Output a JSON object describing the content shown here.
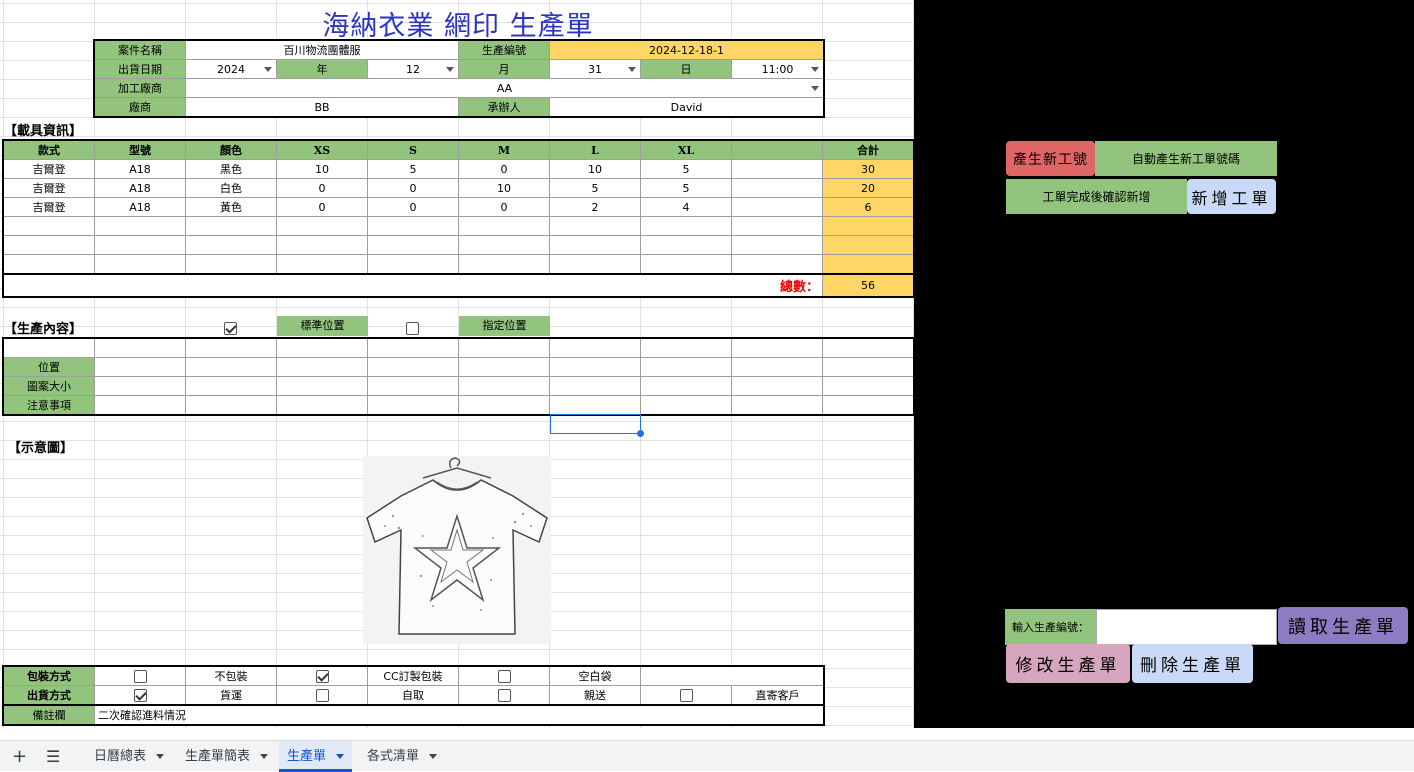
{
  "title": "海納衣業 網印 生產單",
  "info": {
    "case_label": "案件名稱",
    "case_value": "百川物流團體服",
    "prod_no_label": "生產編號",
    "prod_no_value": "2024-12-18-1",
    "ship_label": "出貨日期",
    "year_val": "2024",
    "year_lbl": "年",
    "month_val": "12",
    "month_lbl": "月",
    "day_val": "31",
    "day_lbl": "日",
    "time_val": "11:00",
    "processor_label": "加工廠商",
    "processor_value": "AA",
    "vendor_label": "廠商",
    "vendor_value": "BB",
    "handler_label": "承辦人",
    "handler_value": "David"
  },
  "carrier": {
    "section": "【載具資訊】",
    "headers": [
      "款式",
      "型號",
      "顏色",
      "XS",
      "S",
      "M",
      "L",
      "XL",
      "",
      "合計"
    ],
    "rows": [
      [
        "吉爾登",
        "A18",
        "黑色",
        "10",
        "5",
        "0",
        "10",
        "5",
        "",
        "30"
      ],
      [
        "吉爾登",
        "A18",
        "白色",
        "0",
        "0",
        "10",
        "5",
        "5",
        "",
        "20"
      ],
      [
        "吉爾登",
        "A18",
        "黃色",
        "0",
        "0",
        "0",
        "2",
        "4",
        "",
        "6"
      ],
      [
        "",
        "",
        "",
        "",
        "",
        "",
        "",
        "",
        "",
        ""
      ],
      [
        "",
        "",
        "",
        "",
        "",
        "",
        "",
        "",
        "",
        ""
      ],
      [
        "",
        "",
        "",
        "",
        "",
        "",
        "",
        "",
        "",
        ""
      ]
    ],
    "total_label": "總數：",
    "total_value": "56"
  },
  "production": {
    "section": "【生產內容】",
    "std_pos": "標準位置",
    "custom_pos": "指定位置",
    "std_checked": true,
    "custom_checked": false,
    "rows": [
      "位置",
      "圖案大小",
      "注意事項"
    ]
  },
  "diagram": {
    "section": "【示意圖】"
  },
  "packing": {
    "label": "包裝方式",
    "options": [
      {
        "text": "不包裝",
        "checked": false
      },
      {
        "text": "CC訂製包裝",
        "checked": true
      },
      {
        "text": "空白袋",
        "checked": false
      }
    ]
  },
  "shipping": {
    "label": "出貨方式",
    "options": [
      {
        "text": "貨運",
        "checked": true
      },
      {
        "text": "自取",
        "checked": false
      },
      {
        "text": "親送",
        "checked": false
      },
      {
        "text": "直寄客戶",
        "checked": false
      }
    ]
  },
  "remarks": {
    "label": "備註欄",
    "value": "二次確認進料情況"
  },
  "panel": {
    "new_no_button": "產生新工號",
    "auto_text": "自動產生新工單號碼",
    "confirm_text": "工單完成後確認新增",
    "add_button": "新增工單",
    "input_label": "輸入生產編號：",
    "read_button": "讀取生產單",
    "edit_button": "修改生產單",
    "delete_button": "刪除生產單",
    "colors": {
      "red": "#e06666",
      "green": "#93c47d",
      "blue": "#c9daf8",
      "purple": "#8e7cc3",
      "pink": "#d5a6bd"
    }
  },
  "tabs": [
    "日曆總表",
    "生產單簡表",
    "生產單",
    "各式清單"
  ],
  "active_tab": "生產單"
}
